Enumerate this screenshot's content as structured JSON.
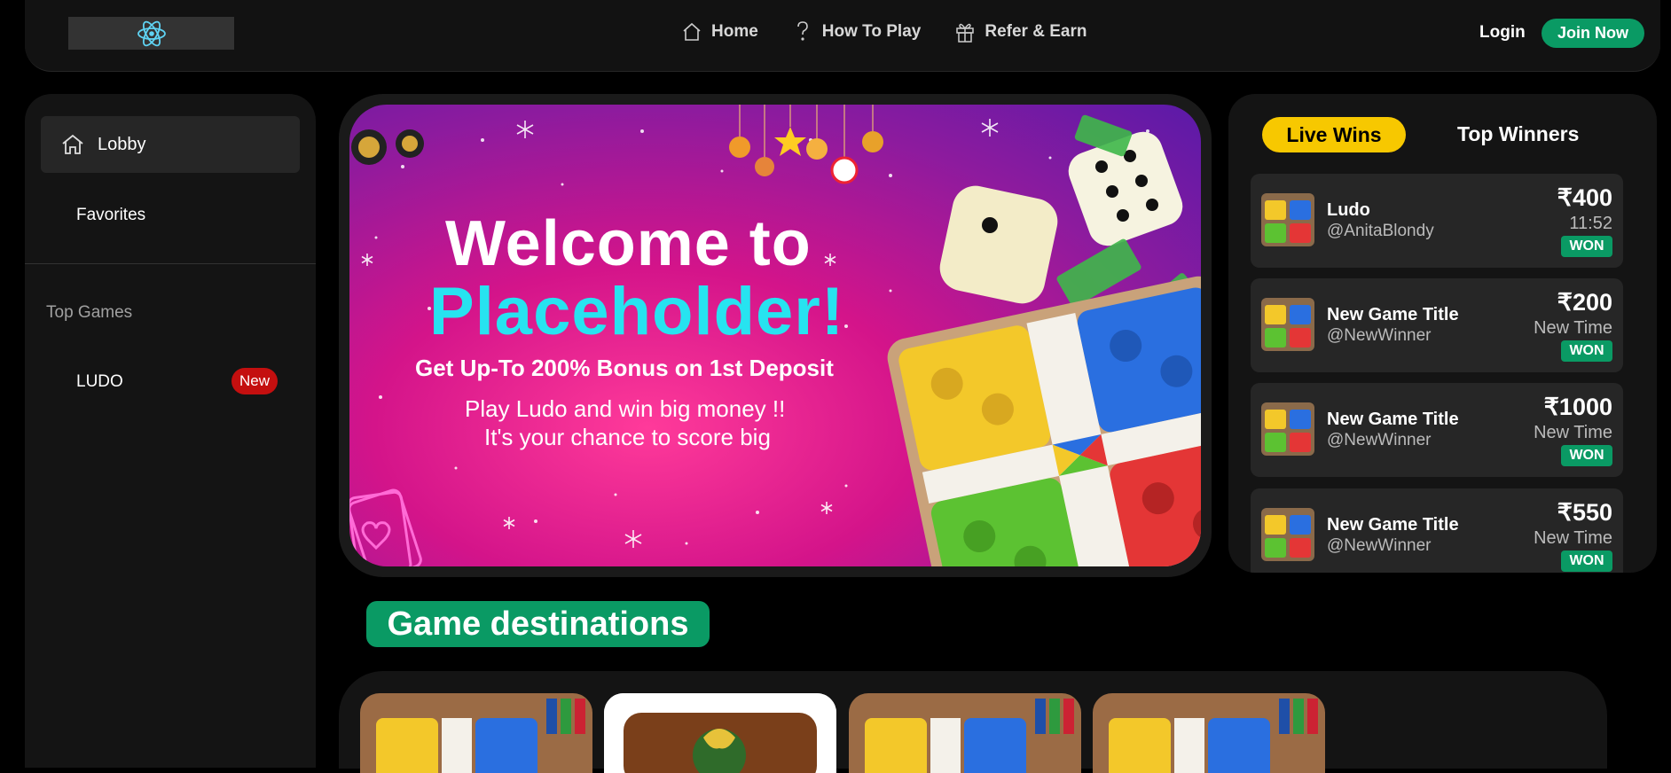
{
  "header": {
    "logo_icon": "react-atom-icon",
    "nav": [
      {
        "label": "Home",
        "icon": "home-icon"
      },
      {
        "label": "How To Play",
        "icon": "question-icon"
      },
      {
        "label": "Refer & Earn",
        "icon": "gift-icon"
      }
    ],
    "login_label": "Login",
    "join_label": "Join Now"
  },
  "sidebar": {
    "lobby_label": "Lobby",
    "favorites_label": "Favorites",
    "section_title": "Top Games",
    "games": [
      {
        "label": "LUDO",
        "badge": "New"
      }
    ]
  },
  "banner": {
    "title_line1": "Welcome to",
    "title_line2": "Placeholder!",
    "subtitle": "Get Up-To 200% Bonus on 1st Deposit",
    "line1": "Play Ludo and win big money !!",
    "line2": "It's your chance to score big"
  },
  "wins": {
    "tab_live": "Live Wins",
    "tab_top": "Top Winners",
    "items": [
      {
        "game": "Ludo",
        "user": "@AnitaBlondy",
        "amount": "₹400",
        "time": "11:52",
        "status": "WON"
      },
      {
        "game": "New Game Title",
        "user": "@NewWinner",
        "amount": "₹200",
        "time": "New Time",
        "status": "WON"
      },
      {
        "game": "New Game Title",
        "user": "@NewWinner",
        "amount": "₹1000",
        "time": "New Time",
        "status": "WON"
      },
      {
        "game": "New Game Title",
        "user": "@NewWinner",
        "amount": "₹550",
        "time": "New Time",
        "status": "WON"
      }
    ]
  },
  "destinations": {
    "title": "Game destinations"
  },
  "colors": {
    "accent_green": "#0a9a64",
    "accent_yellow": "#f7c800",
    "badge_red": "#c40f0f",
    "cyan_title": "#27e3f0"
  }
}
